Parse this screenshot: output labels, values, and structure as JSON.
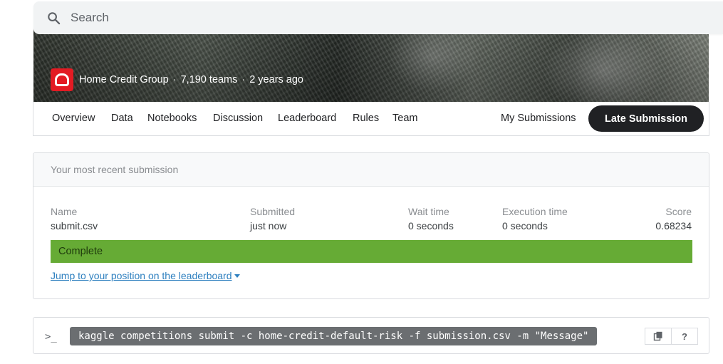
{
  "search": {
    "placeholder": "Search"
  },
  "banner": {
    "host": "Home Credit Group",
    "teams": "7,190 teams",
    "age": "2 years ago",
    "separator": "·"
  },
  "tabs": {
    "overview": "Overview",
    "data": "Data",
    "notebooks": "Notebooks",
    "discussion": "Discussion",
    "leaderboard": "Leaderboard",
    "rules": "Rules",
    "team": "Team",
    "my_submissions": "My Submissions",
    "late_submission": "Late Submission"
  },
  "submission": {
    "header": "Your most recent submission",
    "columns": {
      "name_label": "Name",
      "submitted_label": "Submitted",
      "wait_label": "Wait time",
      "exec_label": "Execution time",
      "score_label": "Score"
    },
    "values": {
      "name": "submit.csv",
      "submitted": "just now",
      "wait": "0 seconds",
      "exec": "0 seconds",
      "score": "0.68234"
    },
    "status": "Complete",
    "status_color": "#66ab35",
    "jump_link": "Jump to your position on the leaderboard"
  },
  "command": {
    "prompt_icon": "terminal-icon",
    "text": "kaggle competitions submit -c home-credit-default-risk -f submission.csv -m \"Message\"",
    "copy_icon": "copy-icon",
    "help_label": "?"
  }
}
